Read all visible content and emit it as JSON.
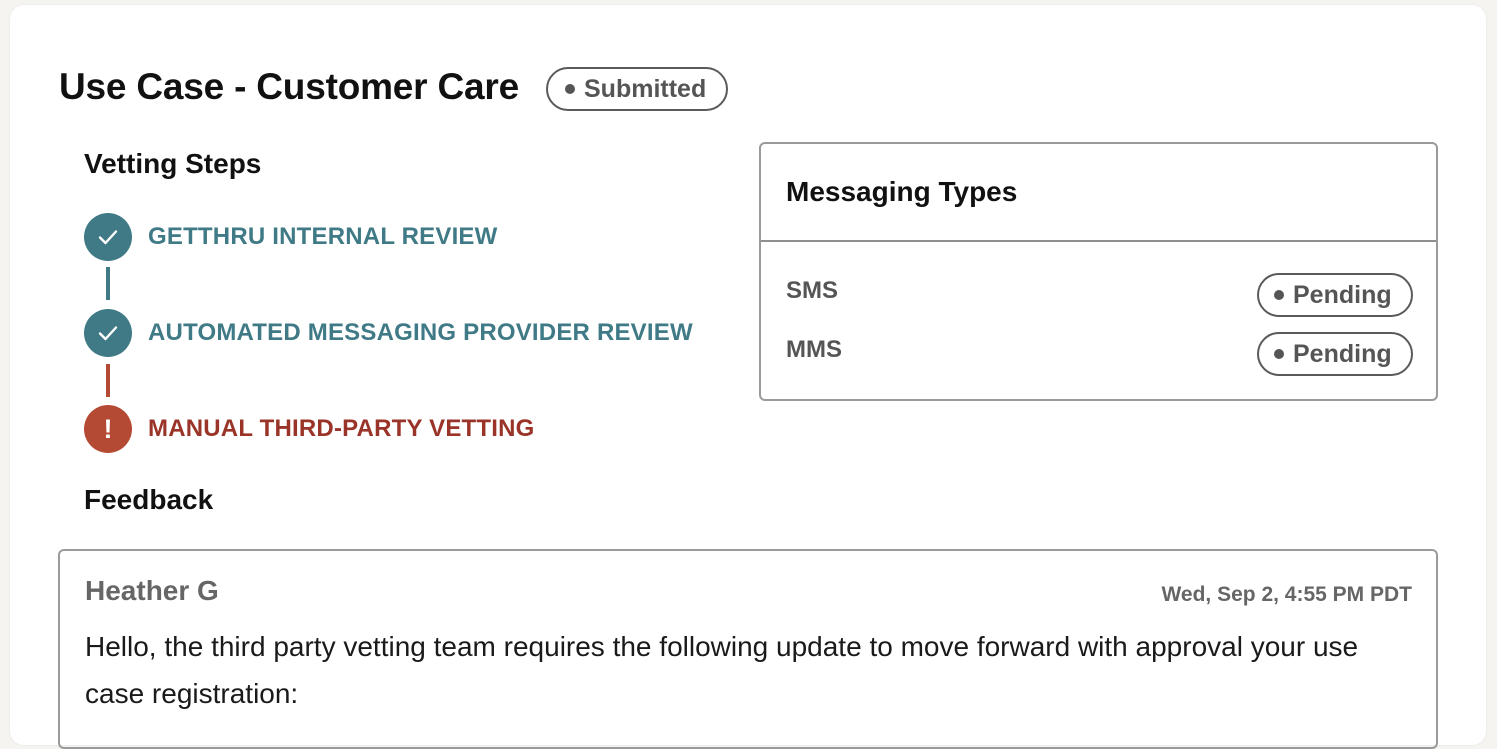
{
  "header": {
    "title": "Use Case - Customer Care",
    "status": "Submitted"
  },
  "vetting": {
    "heading": "Vetting Steps",
    "steps": [
      {
        "label": "GETTHRU INTERNAL REVIEW",
        "state": "complete",
        "icon": "check-icon"
      },
      {
        "label": "AUTOMATED MESSAGING PROVIDER REVIEW",
        "state": "complete",
        "icon": "check-icon"
      },
      {
        "label": "MANUAL THIRD-PARTY VETTING",
        "state": "error",
        "icon": "exclamation-icon",
        "glyph": "!"
      }
    ]
  },
  "messaging": {
    "title": "Messaging Types",
    "types": [
      {
        "name": "SMS",
        "status": "Pending"
      },
      {
        "name": "MMS",
        "status": "Pending"
      }
    ]
  },
  "feedback": {
    "heading": "Feedback",
    "entries": [
      {
        "author": "Heather G",
        "timestamp": "Wed, Sep 2, 4:55 PM PDT",
        "message": "Hello, the third party vetting team requires the following update to move forward with approval your use case registration:"
      }
    ]
  },
  "colors": {
    "teal": "#3f7a86",
    "error_red": "#b54a34",
    "error_text": "#9a3428",
    "neutral_gray": "#555555"
  }
}
